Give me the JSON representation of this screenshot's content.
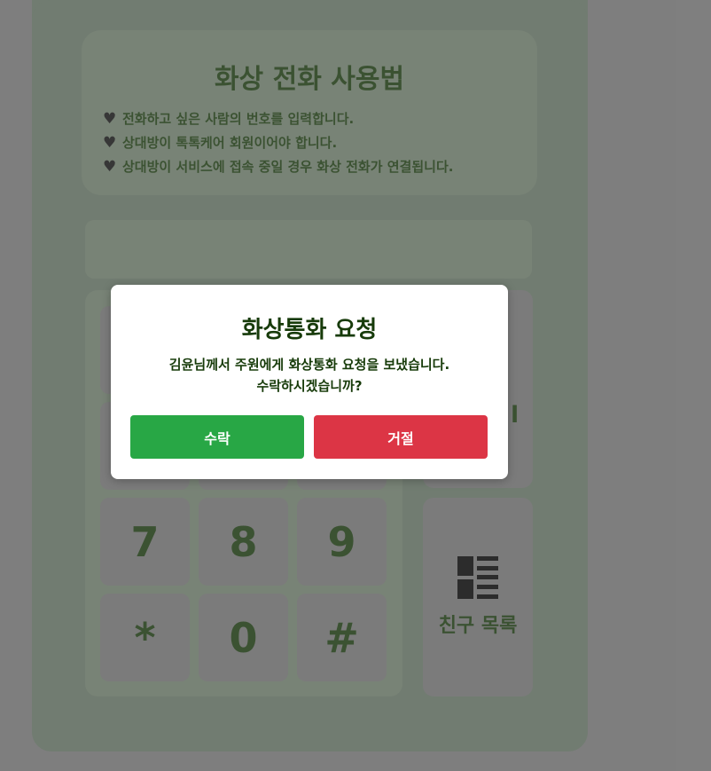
{
  "guide": {
    "title": "화상 전화 사용법",
    "items": [
      "전화하고 싶은 사람의 번호를 입력합니다.",
      "상대방이 톡톡케어 회원이어야 합니다.",
      "상대방이 서비스에 접속 중일 경우 화상 전화가 연결됩니다."
    ],
    "bullet_icon": "black-heart-icon"
  },
  "keypad": {
    "keys_row3": [
      "7",
      "8",
      "9"
    ],
    "keys_row4": [
      "*",
      "0",
      "#"
    ]
  },
  "side": {
    "video_label_partial": "l",
    "friends_label": "친구 목록",
    "friends_icon": "list-icon"
  },
  "modal": {
    "title": "화상통화 요청",
    "message_line1": "김윤님께서 주원에게 화상통화 요청을 보냈습니다.",
    "message_line2": "수락하시겠습니까?",
    "accept_label": "수락",
    "reject_label": "거절",
    "accept_color": "#28a745",
    "reject_color": "#dc3545"
  }
}
